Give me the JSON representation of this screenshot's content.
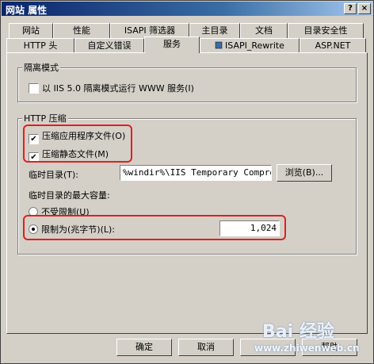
{
  "window": {
    "title": "网站 属性",
    "help": "?",
    "close": "×"
  },
  "tabs_row1": [
    "网站",
    "性能",
    "ISAPI 筛选器",
    "主目录",
    "文档",
    "目录安全性"
  ],
  "tabs_row2": [
    "HTTP 头",
    "自定义错误",
    "服务",
    "ISAPI_Rewrite",
    "ASP.NET"
  ],
  "isolation": {
    "legend": "隔离模式",
    "checkbox_label": "以 IIS 5.0 隔离模式运行 WWW 服务(I)",
    "checked": false
  },
  "compression": {
    "legend": "HTTP 压缩",
    "app_files_label": "压缩应用程序文件(O)",
    "app_files_checked": true,
    "static_files_label": "压缩静态文件(M)",
    "static_files_checked": true,
    "temp_dir_label": "临时目录(T):",
    "temp_dir_value": "%windir%\\IIS Temporary Compres",
    "browse_label": "浏览(B)...",
    "max_size_label": "临时目录的最大容量:",
    "unlimited_label": "不受限制(U)",
    "limit_label": "限制为(兆字节)(L):",
    "limit_value": "1,024",
    "selected": "limit"
  },
  "footer": {
    "ok": "确定",
    "cancel": "取消",
    "help": "帮助"
  },
  "watermark": {
    "logo": "Bai 经验",
    "url": "www.zhiwenweb.cn"
  },
  "colors": {
    "highlight": "#e02020",
    "titlebar": "#0a246a",
    "face": "#d4d0c8"
  }
}
